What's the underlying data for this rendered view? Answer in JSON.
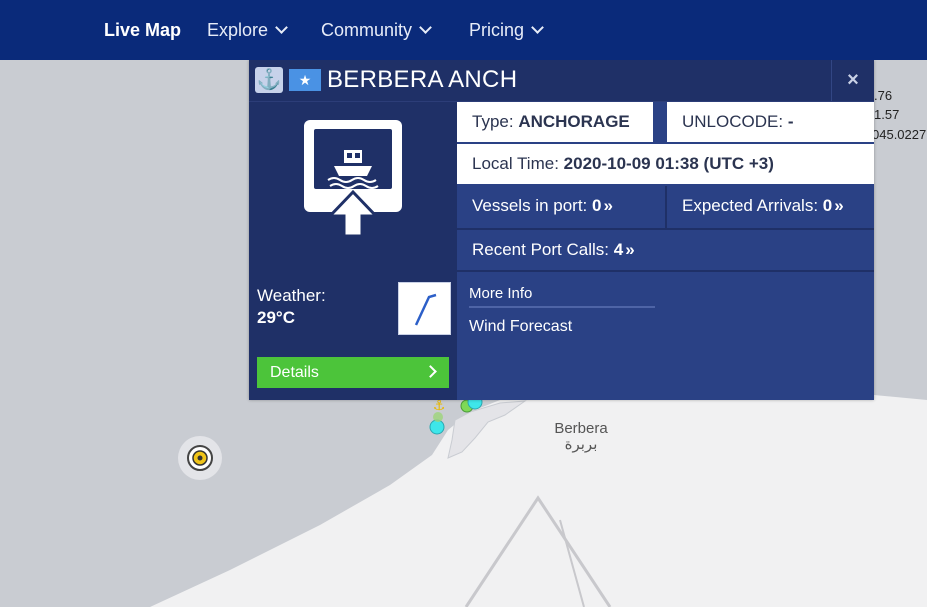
{
  "nav": {
    "live_map": "Live Map",
    "explore": "Explore",
    "community": "Community",
    "pricing": "Pricing"
  },
  "popup": {
    "port_name": "BERBERA ANCH",
    "close_symbol": "×",
    "anchor_symbol": "⚓",
    "flag_symbol": "★",
    "type_label": "Type:",
    "type_value": "ANCHORAGE",
    "unlocode_label": "UNLOCODE:",
    "unlocode_value": "-",
    "local_time_label": "Local Time:",
    "local_time_value": "2020-10-09 01:38 (UTC +3)",
    "vessels_label": "Vessels in port:",
    "vessels_value": "0",
    "arrivals_label": "Expected Arrivals:",
    "arrivals_value": "0",
    "recent_calls_label": "Recent Port Calls:",
    "recent_calls_value": "4",
    "more_info": "More Info",
    "wind_forecast": "Wind Forecast",
    "weather_label": "Weather:",
    "weather_temp": "29°C",
    "details_label": "Details",
    "chevrons": "»"
  },
  "map": {
    "city_name": "Berbera",
    "city_name_ar": "بربرة",
    "coord_1": ".76",
    "coord_2": "1.57",
    "coord_3": "045.0227"
  },
  "colors": {
    "nav_bg": "#0a2a7a",
    "popup_bg": "#1f3067",
    "panel_bg": "#2a4185",
    "details_green": "#4cc43a",
    "sea": "#c9ccd2",
    "land": "#f1f1f2",
    "vessel_cyan": "#3ee6ea"
  },
  "icons": [
    "anchor-icon",
    "somalia-flag-icon",
    "close-icon",
    "port-vessel-icon",
    "wind-direction-icon",
    "chevron-right-icon",
    "chevron-down-icon",
    "lighthouse-marker-icon",
    "vessel-marker-icon"
  ]
}
